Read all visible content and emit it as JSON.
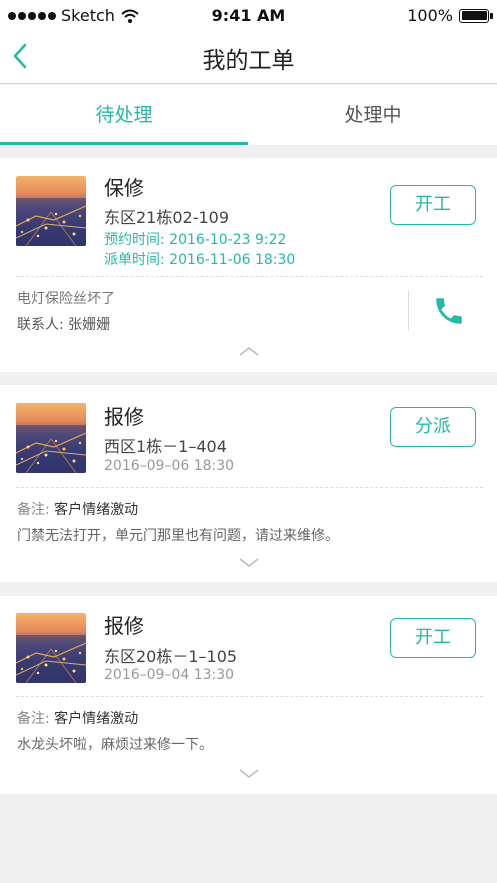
{
  "status_bar": {
    "carrier": "Sketch",
    "time": "9:41 AM",
    "battery": "100%"
  },
  "nav": {
    "title": "我的工单"
  },
  "tabs": [
    {
      "label": "待处理"
    },
    {
      "label": "处理中"
    }
  ],
  "orders": [
    {
      "title": "保修",
      "address": "东区21栋02-109",
      "appointment_label": "预约时间:",
      "appointment_time": "2016-10-23   9:22",
      "dispatch_label": "派单时间:",
      "dispatch_time": "2016-11-06 18:30",
      "action_label": "开工",
      "fault": "电灯保险丝坏了",
      "contact_label": "联系人:",
      "contact_name": "张姗姗"
    },
    {
      "title": "报修",
      "address": "西区1栋－1–404",
      "time": "2016–09–06 18:30",
      "action_label": "分派",
      "note_label": "备注:",
      "note_value": "客户情绪激动",
      "description": "门禁无法打开，单元门那里也有问题，请过来维修。"
    },
    {
      "title": "报修",
      "address": "东区20栋－1–105",
      "time": "2016–09–04 13:30",
      "action_label": "开工",
      "note_label": "备注:",
      "note_value": "客户情绪激动",
      "description": "水龙头坏啦，麻烦过来修一下。"
    }
  ],
  "colors": {
    "accent": "#26b9a5",
    "background": "#f0f0f0"
  },
  "icons": {
    "back": "chevron-left-icon",
    "phone": "phone-icon",
    "collapse": "chevron-up-icon",
    "expand": "chevron-down-icon",
    "wifi": "wifi-icon",
    "battery": "battery-icon"
  }
}
